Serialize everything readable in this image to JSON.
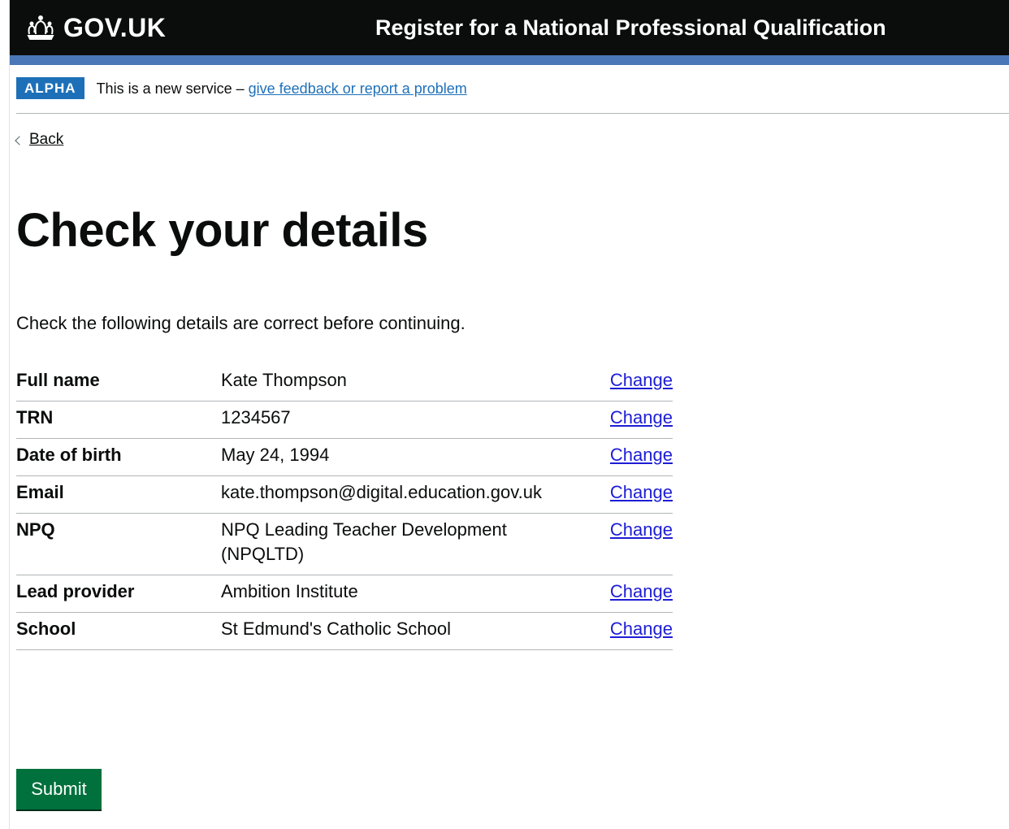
{
  "header": {
    "logo_text": "GOV.UK",
    "service_name": "Register for a National Professional Qualification",
    "bar_color": "#4a77b8",
    "logo_icon": "crown-icon"
  },
  "phase_banner": {
    "tag": "ALPHA",
    "text": "This is a new service – ",
    "link_text": "give feedback or report a problem"
  },
  "back_link": {
    "label": "Back",
    "icon": "chevron-left-icon"
  },
  "main": {
    "title": "Check your details",
    "intro": "Check the following details are correct before continuing.",
    "rows": [
      {
        "key": "Full name",
        "value": "Kate Thompson",
        "action": "Change"
      },
      {
        "key": "TRN",
        "value": "1234567",
        "action": "Change"
      },
      {
        "key": "Date of birth",
        "value": "May 24, 1994",
        "action": "Change"
      },
      {
        "key": "Email",
        "value": "kate.thompson@digital.education.gov.uk",
        "action": "Change"
      },
      {
        "key": "NPQ",
        "value": "NPQ Leading Teacher Development (NPQLTD)",
        "action": "Change"
      },
      {
        "key": "Lead provider",
        "value": "Ambition Institute",
        "action": "Change"
      },
      {
        "key": "School",
        "value": "St Edmund's Catholic School",
        "action": "Change"
      }
    ],
    "submit_label": "Submit"
  }
}
